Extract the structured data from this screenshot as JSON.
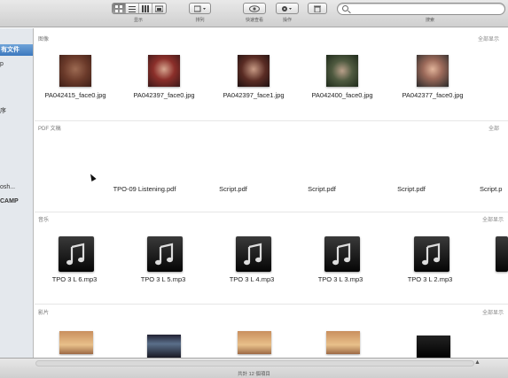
{
  "toolbar": {
    "view_label": "显示",
    "arrange_label": "排列",
    "quicklook_label": "快速查看",
    "action_label": "操作",
    "search_label": "搜索"
  },
  "sidebar": {
    "items": [
      {
        "label": "有文件",
        "selected": true
      },
      {
        "label": "p"
      },
      {
        "label": "序"
      },
      {
        "label": "osh..."
      },
      {
        "label": "CAMP"
      }
    ]
  },
  "sections": {
    "images": {
      "header": "图像",
      "more": "全部显示",
      "items": [
        {
          "name": "PA042415_face0.jpg",
          "icon": "photo-thumbnail"
        },
        {
          "name": "PA042397_face0.jpg",
          "icon": "photo-thumbnail"
        },
        {
          "name": "PA042397_face1.jpg",
          "icon": "photo-thumbnail"
        },
        {
          "name": "PA042400_face0.jpg",
          "icon": "photo-thumbnail"
        },
        {
          "name": "PA042377_face0.jpg",
          "icon": "photo-thumbnail"
        }
      ]
    },
    "pdf": {
      "header": "PDF 文稿",
      "more": "全部",
      "items": [
        {
          "name": "TPO-09 Listening.pdf"
        },
        {
          "name": "Script.pdf"
        },
        {
          "name": "Script.pdf"
        },
        {
          "name": "Script.pdf"
        },
        {
          "name": "Script.p"
        }
      ]
    },
    "music": {
      "header": "音乐",
      "more": "全部显示",
      "items": [
        {
          "name": "TPO 3 L 6.mp3",
          "icon": "music-note-icon"
        },
        {
          "name": "TPO 3 L 5.mp3",
          "icon": "music-note-icon"
        },
        {
          "name": "TPO 3 L 4.mp3",
          "icon": "music-note-icon"
        },
        {
          "name": "TPO 3 L 3.mp3",
          "icon": "music-note-icon"
        },
        {
          "name": "TPO 3 L 2.mp3",
          "icon": "music-note-icon"
        }
      ]
    },
    "movies": {
      "header": "影片",
      "more": "全部显示"
    }
  },
  "statusbar": {
    "text": "共計 12 個項目"
  }
}
